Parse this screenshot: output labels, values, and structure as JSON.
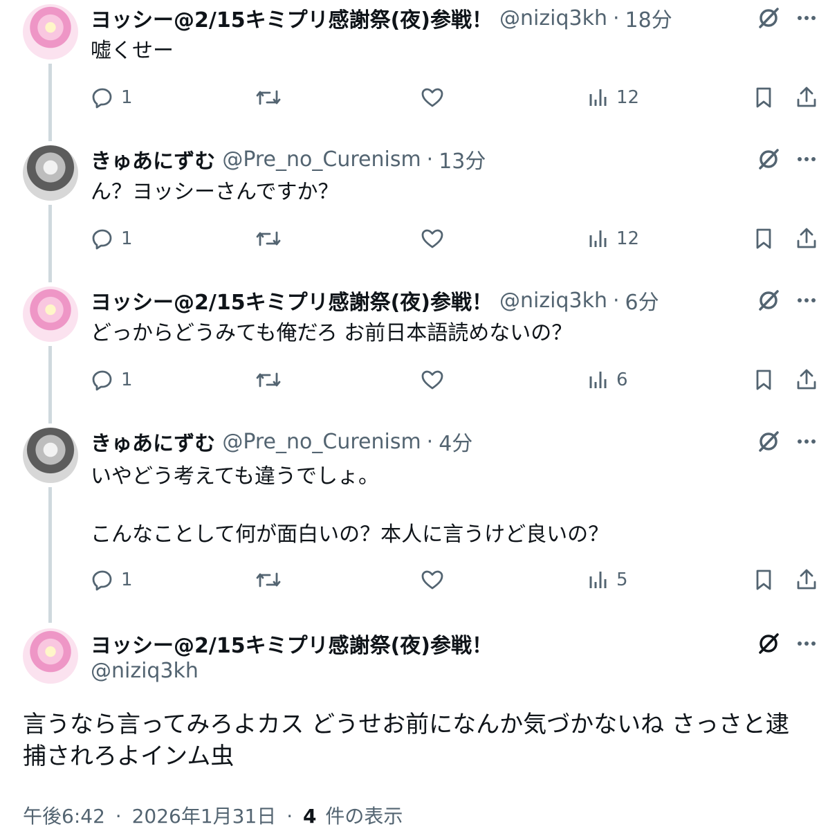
{
  "replies": [
    {
      "name": "ヨッシー@2/15キミプリ感謝祭(夜)参戦！",
      "handle": "@niziq3kh",
      "time": "18分",
      "text": "嘘くせー",
      "replies": "1",
      "views": "12",
      "avatar": "pink"
    },
    {
      "name": "きゅあにずむ",
      "handle": "@Pre_no_Curenism",
      "time": "13分",
      "text": "ん？ヨッシーさんですか？",
      "replies": "1",
      "views": "12",
      "avatar": "gray"
    },
    {
      "name": "ヨッシー@2/15キミプリ感謝祭(夜)参戦！",
      "handle": "@niziq3kh",
      "time": "6分",
      "text": "どっからどうみても俺だろ お前日本語読めないの？",
      "replies": "1",
      "views": "6",
      "avatar": "pink"
    },
    {
      "name": "きゅあにずむ",
      "handle": "@Pre_no_Curenism",
      "time": "4分",
      "text": "いやどう考えても違うでしょ。\n\nこんなことして何が面白いの？本人に言うけど良いの？",
      "replies": "1",
      "views": "5",
      "avatar": "gray"
    }
  ],
  "main_tweet": {
    "name": "ヨッシー@2/15キミプリ感謝祭(夜)参戦！",
    "handle": "@niziq3kh",
    "text": "言うなら言ってみろよカス どうせお前になんか気づかないね さっさと逮捕されろよインム虫",
    "time": "午後6:42",
    "date": "2026年1月31日",
    "views_count": "4",
    "views_label": "件の表示"
  },
  "separator": "·",
  "icons": {
    "translate": "translate-icon",
    "more": "more-icon",
    "reply": "reply-icon",
    "retweet": "retweet-icon",
    "like": "like-icon",
    "views": "views-icon",
    "bookmark": "bookmark-icon",
    "share": "share-icon"
  },
  "colors": {
    "text": "#0f1419",
    "secondary": "#536471",
    "thread_line": "#cfd9de"
  }
}
